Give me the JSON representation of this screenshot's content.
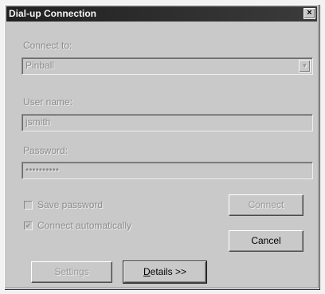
{
  "window": {
    "title": "Dial-up Connection",
    "close_symbol": "×"
  },
  "fields": {
    "connect_label": "Connect to:",
    "connect_value": "Pinball",
    "username_label": "User name:",
    "username_value": "jsmith",
    "password_label": "Password:",
    "password_value": "••••••••••"
  },
  "checkboxes": {
    "save_password": "Save password",
    "connect_auto": "Connect automatically"
  },
  "buttons": {
    "connect": "Connect",
    "cancel": "Cancel",
    "settings": "Settings",
    "details_prefix": "D",
    "details_rest": "etails >>"
  },
  "icons": {
    "dropdown": "chevron-down-icon",
    "check": "✔"
  }
}
